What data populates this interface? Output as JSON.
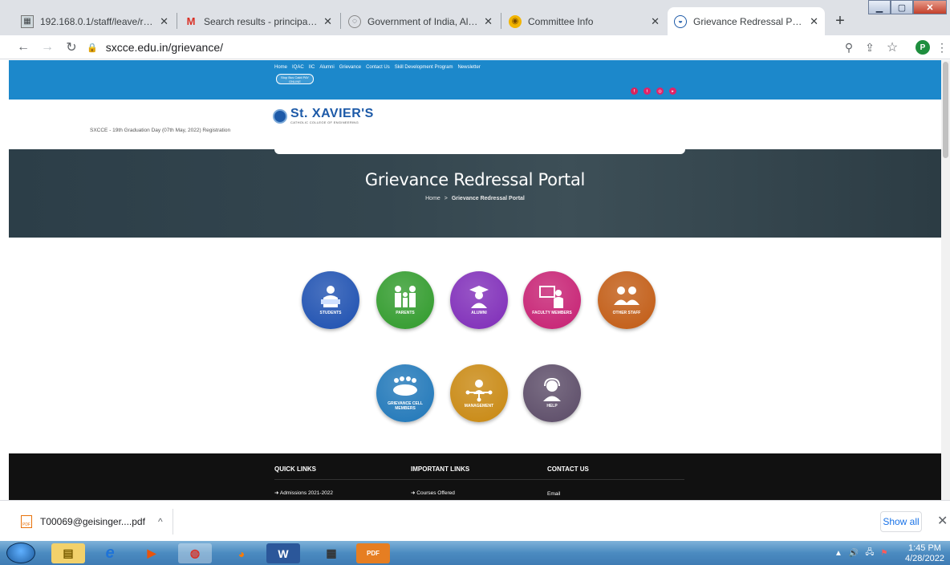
{
  "browser": {
    "tabs": [
      {
        "title": "192.168.0.1/staff/leave/rep_leav",
        "active": false
      },
      {
        "title": "Search results - principal@sxcce",
        "active": false
      },
      {
        "title": "Government of India, All India C",
        "active": false
      },
      {
        "title": "Committee Info",
        "active": false
      },
      {
        "title": "Grievance Redressal Portal – St.",
        "active": true
      }
    ],
    "new_tab": "+",
    "url": "sxcce.edu.in/grievance/",
    "profile_initial": "P"
  },
  "site": {
    "top_nav": [
      "Home",
      "IQAC",
      "IIC",
      "Alumni",
      "Grievance",
      "Contact Us",
      "Skill Development Program",
      "Newsletter"
    ],
    "bsm_badge": "Stop Bus Cakti PAY ONLINE",
    "graduation_link": "SXCCE - 19th Graduation Day (07th May, 2022) Registration",
    "logo_name": "St. XAVIER'S",
    "logo_subtitle": "CATHOLIC COLLEGE OF ENGINEERING",
    "hero_title": "Grievance Redressal Portal",
    "breadcrumb_home": "Home",
    "breadcrumb_sep": ">",
    "breadcrumb_current": "Grievance Redressal Portal"
  },
  "categories": [
    {
      "label": "STUDENTS",
      "color": "#1c4fb0"
    },
    {
      "label": "PARENTS",
      "color": "#2f9a2a"
    },
    {
      "label": "ALUMNI",
      "color": "#7e2bb8"
    },
    {
      "label": "FACULTY MEMBERS",
      "color": "#c61f72"
    },
    {
      "label": "OTHER STAFF",
      "color": "#c15a12"
    },
    {
      "label": "GRIEVANCE CELL MEMBERS",
      "color": "#1e76b8"
    },
    {
      "label": "MANAGEMENT",
      "color": "#c8870f"
    },
    {
      "label": "HELP",
      "color": "#5a4a66"
    }
  ],
  "footer": {
    "quick_links_title": "QUICK LINKS",
    "quick_link_1": "Admissions 2021-2022",
    "important_links_title": "IMPORTANT LINKS",
    "important_link_1": "Courses Offered",
    "contact_title": "CONTACT US",
    "contact_1": "Email"
  },
  "download_bar": {
    "filename": "T00069@geisinger....pdf",
    "show_all": "Show all"
  },
  "taskbar": {
    "time": "1:45 PM",
    "date": "4/28/2022"
  }
}
